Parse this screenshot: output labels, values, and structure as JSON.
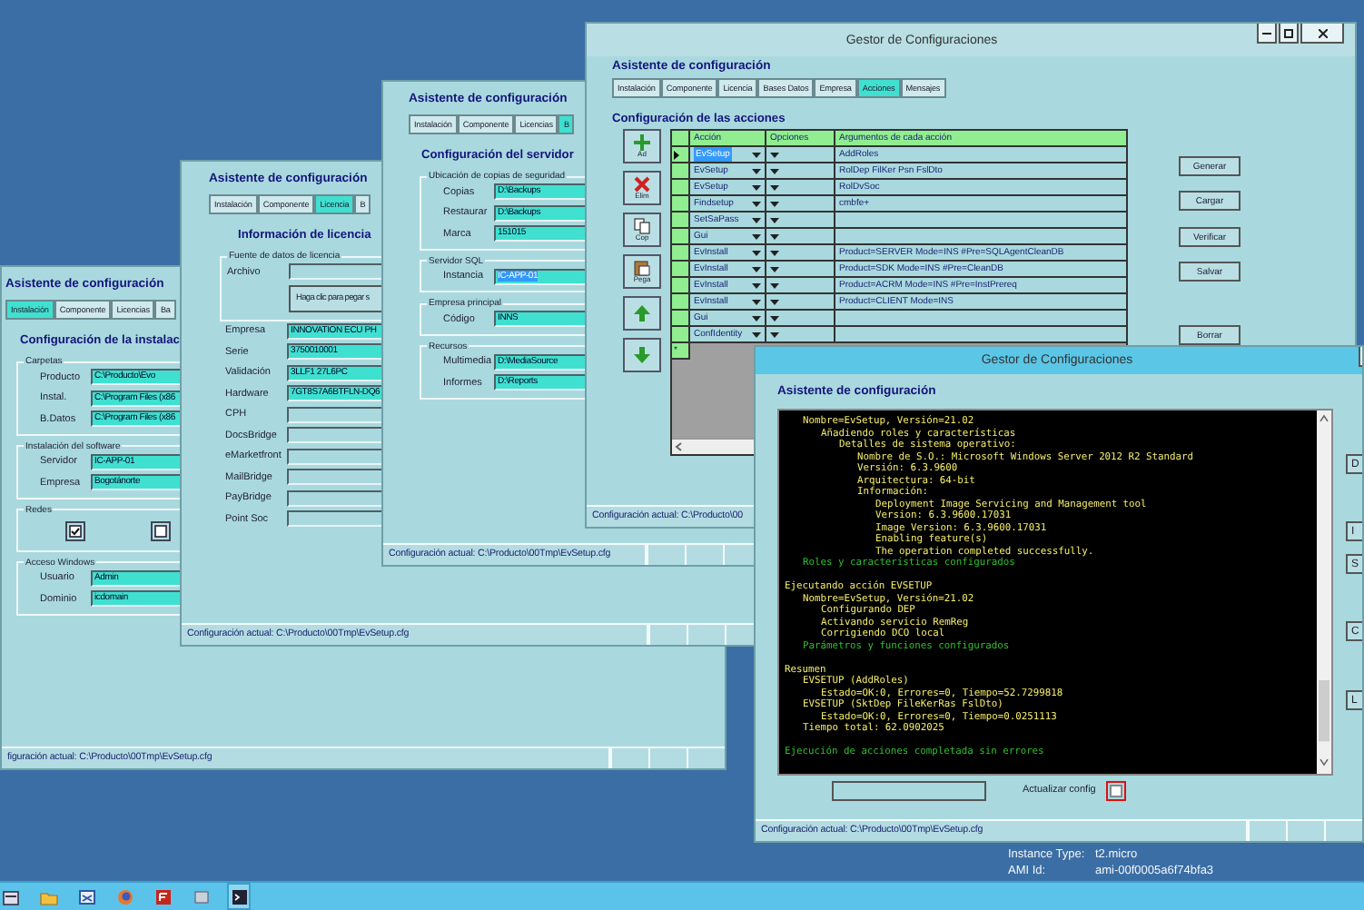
{
  "windows": [
    {
      "kind": "form",
      "heading": "Asistente de configuración",
      "tabs": [
        {
          "label": "Instalación",
          "selected": true
        },
        {
          "label": "Componente",
          "selected": false
        },
        {
          "label": "Licencias",
          "selected": false
        },
        {
          "label": "Ba",
          "selected": false
        }
      ],
      "section": "Configuración de la instalac",
      "items": [
        {
          "kind": "group",
          "legend": "Carpetas",
          "rows": [
            {
              "kind": "field",
              "label": "Producto",
              "value": "C:\\Producto\\Evo"
            },
            {
              "kind": "field",
              "label": "Instal.",
              "value": "C:\\Program Files (x86"
            },
            {
              "kind": "field",
              "label": "B.Datos",
              "value": "C:\\Program Files (x86"
            }
          ]
        },
        {
          "kind": "group",
          "legend": "Instalación del software",
          "rows": [
            {
              "kind": "field",
              "label": "Servidor",
              "value": "IC-APP-01"
            },
            {
              "kind": "field",
              "label": "Empresa",
              "value": "Bogotánorte"
            }
          ]
        },
        {
          "kind": "group",
          "legend": "Redes",
          "rows": [
            {
              "kind": "checks",
              "boxes": [
                {
                  "checked": true
                },
                {
                  "checked": false
                }
              ]
            }
          ]
        },
        {
          "kind": "group",
          "legend": "Acceso Windows",
          "rows": [
            {
              "kind": "field",
              "label": "Usuario",
              "value": "Admin"
            },
            {
              "kind": "field",
              "label": "Dominio",
              "value": "icdomain"
            }
          ]
        }
      ],
      "status": "figuración actual: C:\\Producto\\00Tmp\\EvSetup.cfg"
    },
    {
      "kind": "form",
      "heading": "Asistente de configuración",
      "tabs": [
        {
          "label": "Instalación",
          "selected": false
        },
        {
          "label": "Componente",
          "selected": false
        },
        {
          "label": "Licencia",
          "selected": true
        },
        {
          "label": "B",
          "selected": false
        }
      ],
      "section": "Información de licencia",
      "items": [
        {
          "kind": "group",
          "legend": "Fuente de datos de licencia",
          "rows": [
            {
              "kind": "field",
              "label": "Archivo"
            },
            {
              "kind": "button",
              "label": "Haga clic para pegar s"
            }
          ]
        },
        {
          "kind": "field",
          "label": "Empresa",
          "value": "INNOVATION ECU PH"
        },
        {
          "kind": "field",
          "label": "Serie",
          "value": "3750010001"
        },
        {
          "kind": "field",
          "label": "Validación",
          "value": "3LLF1 27L6PC"
        },
        {
          "kind": "field",
          "label": "Hardware",
          "value": "7GT8S7A6BTFLN-DQ6"
        },
        {
          "kind": "field",
          "label": "CPH"
        },
        {
          "kind": "field",
          "label": "DocsBridge"
        },
        {
          "kind": "field",
          "label": "eMarketfront"
        },
        {
          "kind": "field",
          "label": "MailBridge"
        },
        {
          "kind": "field",
          "label": "PayBridge"
        },
        {
          "kind": "field",
          "label": "Point Soc"
        }
      ],
      "status": "Configuración actual: C:\\Producto\\00Tmp\\EvSetup.cfg"
    },
    {
      "kind": "form",
      "heading": "Asistente de configuración",
      "tabs": [
        {
          "label": "Instalación",
          "selected": false
        },
        {
          "label": "Componente",
          "selected": false
        },
        {
          "label": "Licencias",
          "selected": false
        },
        {
          "label": "B",
          "selected": true
        }
      ],
      "section": "Configuración del servidor",
      "items": [
        {
          "kind": "group",
          "legend": "Ubicación de copias de seguridad",
          "rows": [
            {
              "kind": "field",
              "label": "Copias",
              "value": "D:\\Backups",
              "selected": false
            },
            {
              "kind": "field",
              "label": "Restaurar",
              "value": "D:\\Backups",
              "selected": false
            },
            {
              "kind": "field",
              "label": "Marca",
              "value": "151015",
              "selected": false
            }
          ]
        },
        {
          "kind": "group",
          "legend": "Servidor SQL",
          "rows": [
            {
              "kind": "field",
              "label": "Instancia",
              "value": "IC-APP-01",
              "selected": true
            }
          ]
        },
        {
          "kind": "group",
          "legend": "Empresa principal",
          "rows": [
            {
              "kind": "field",
              "label": "Código",
              "value": "INNS",
              "selected": false
            }
          ]
        },
        {
          "kind": "group",
          "legend": "Recursos",
          "rows": [
            {
              "kind": "field",
              "label": "Multimedia",
              "value": "D:\\MediaSource",
              "selected": false
            },
            {
              "kind": "field",
              "label": "Informes",
              "value": "D:\\Reports",
              "selected": false
            }
          ]
        }
      ],
      "status": "Configuración actual: C:\\Producto\\00Tmp\\EvSetup.cfg"
    },
    {
      "kind": "actions",
      "title": "Gestor de Configuraciones",
      "active": false,
      "heading": "Asistente de configuración",
      "tabs": [
        {
          "label": "Instalación",
          "selected": false
        },
        {
          "label": "Componente",
          "selected": false
        },
        {
          "label": "Licencia",
          "selected": false
        },
        {
          "label": "Bases Datos",
          "selected": false
        },
        {
          "label": "Empresa",
          "selected": false
        },
        {
          "label": "Acciones",
          "selected": true
        },
        {
          "label": "Mensajes",
          "selected": false
        }
      ],
      "section": "Configuración de las acciones",
      "tool_buttons": [
        {
          "kind": "add",
          "label": "Ad"
        },
        {
          "kind": "delete",
          "label": "Elim"
        },
        {
          "kind": "copy",
          "label": "Cop"
        },
        {
          "kind": "paste",
          "label": "Pega"
        },
        {
          "kind": "up"
        },
        {
          "kind": "down"
        }
      ],
      "grid": {
        "columns": [
          "Acción",
          "Opciones",
          "Argumentos de cada acción"
        ],
        "rows": [
          {
            "action": "EvSetup",
            "arguments": "AddRoles",
            "selected": true
          },
          {
            "action": "EvSetup",
            "arguments": "RolDep FilKer Psn FslDto",
            "selected": false
          },
          {
            "action": "EvSetup",
            "arguments": "RolDvSoc",
            "selected": false
          },
          {
            "action": "Findsetup",
            "arguments": "cmbfe+",
            "selected": false
          },
          {
            "action": "SetSaPass",
            "selected": false
          },
          {
            "action": "Gui",
            "selected": false
          },
          {
            "action": "EvInstall",
            "arguments": "Product=SERVER Mode=INS #Pre=SQLAgentCleanDB",
            "selected": false
          },
          {
            "action": "EvInstall",
            "arguments": "Product=SDK Mode=INS #Pre=CleanDB",
            "selected": false
          },
          {
            "action": "EvInstall",
            "arguments": "Product=ACRM Mode=INS #Pre=InstPrereq",
            "selected": false
          },
          {
            "action": "EvInstall",
            "arguments": "Product=CLIENT Mode=INS",
            "selected": false
          },
          {
            "action": "Gui",
            "selected": false
          },
          {
            "action": "ConfIdentity",
            "selected": false
          }
        ],
        "new_row_marker": "*"
      },
      "side_buttons": [
        "Generar",
        "Cargar",
        "Verificar",
        "Salvar",
        "Borrar"
      ],
      "status": "Configuración actual: C:\\Producto\\00"
    },
    {
      "kind": "console",
      "title": "Gestor de Configuraciones",
      "active": true,
      "heading": "Asistente de configuración",
      "console": [
        [
          {
            "children": [
              {
                "text": "Nombre=EvSetup, Versión=21.02",
                "kind": "text",
                "children": [
                  {
                    "text": "Añadiendo roles y características",
                    "kind": "text",
                    "children": [
                      {
                        "text": "Detalles de sistema operativo:",
                        "kind": "text",
                        "children": [
                          {
                            "text": "Nombre de S.O.: Microsoft Windows Server 2012 R2 Standard",
                            "kind": "text"
                          },
                          {
                            "text": "Versión: 6.3.9600",
                            "kind": "text"
                          },
                          {
                            "text": "Arquitectura: 64-bit",
                            "kind": "text"
                          },
                          {
                            "text": "Información:",
                            "kind": "text",
                            "children": [
                              {
                                "text": "Deployment Image Servicing and Management tool",
                                "kind": "text"
                              },
                              {
                                "text": "Version: 6.3.9600.17031",
                                "kind": "text"
                              },
                              {
                                "text": "Image Version: 6.3.9600.17031",
                                "kind": "text"
                              },
                              {
                                "text": "Enabling feature(s)",
                                "kind": "text"
                              },
                              {
                                "text": "The operation completed successfully.",
                                "kind": "text"
                              }
                            ]
                          }
                        ]
                      }
                    ]
                  }
                ]
              },
              {
                "text": "Roles y características configurados",
                "kind": "ok"
              }
            ]
          }
        ],
        [
          {
            "text": "Ejecutando acción EVSETUP",
            "kind": "text",
            "children": [
              {
                "text": "Nombre=EvSetup, Versión=21.02",
                "kind": "text",
                "children": [
                  {
                    "text": "Configurando DEP",
                    "kind": "text"
                  },
                  {
                    "text": "Activando servicio RemReg",
                    "kind": "text"
                  },
                  {
                    "text": "Corrigiendo DCO local",
                    "kind": "text"
                  }
                ]
              },
              {
                "text": "Parámetros y funciones configurados",
                "kind": "ok"
              }
            ]
          }
        ],
        [
          {
            "text": "Resumen",
            "kind": "text",
            "children": [
              {
                "text": "EVSETUP (AddRoles)",
                "kind": "text",
                "children": [
                  {
                    "text": "Estado=OK:0, Errores=0, Tiempo=52.7299818",
                    "kind": "text"
                  }
                ]
              },
              {
                "text": "EVSETUP (SktDep FileKerRas FslDto)",
                "kind": "text",
                "children": [
                  {
                    "text": "Estado=OK:0, Errores=0, Tiempo=0.0251113",
                    "kind": "text"
                  }
                ]
              },
              {
                "text": "Tiempo total: 62.0902025",
                "kind": "text"
              }
            ]
          }
        ],
        [
          {
            "text": "Ejecución de acciones completada sin errores",
            "kind": "ok"
          }
        ]
      ],
      "option_label": "Actualizar config",
      "option_checked": false,
      "side_buttons": [
        "D",
        "I",
        "S",
        "C",
        "L"
      ],
      "status": "Configuración actual: C:\\Producto\\00Tmp\\EvSetup.cfg"
    }
  ],
  "system_info": [
    {
      "label": "Instance Type:",
      "value": "t2.micro"
    },
    {
      "label": "AMI Id:",
      "value": "ami-00f0005a6f74bfa3"
    }
  ]
}
